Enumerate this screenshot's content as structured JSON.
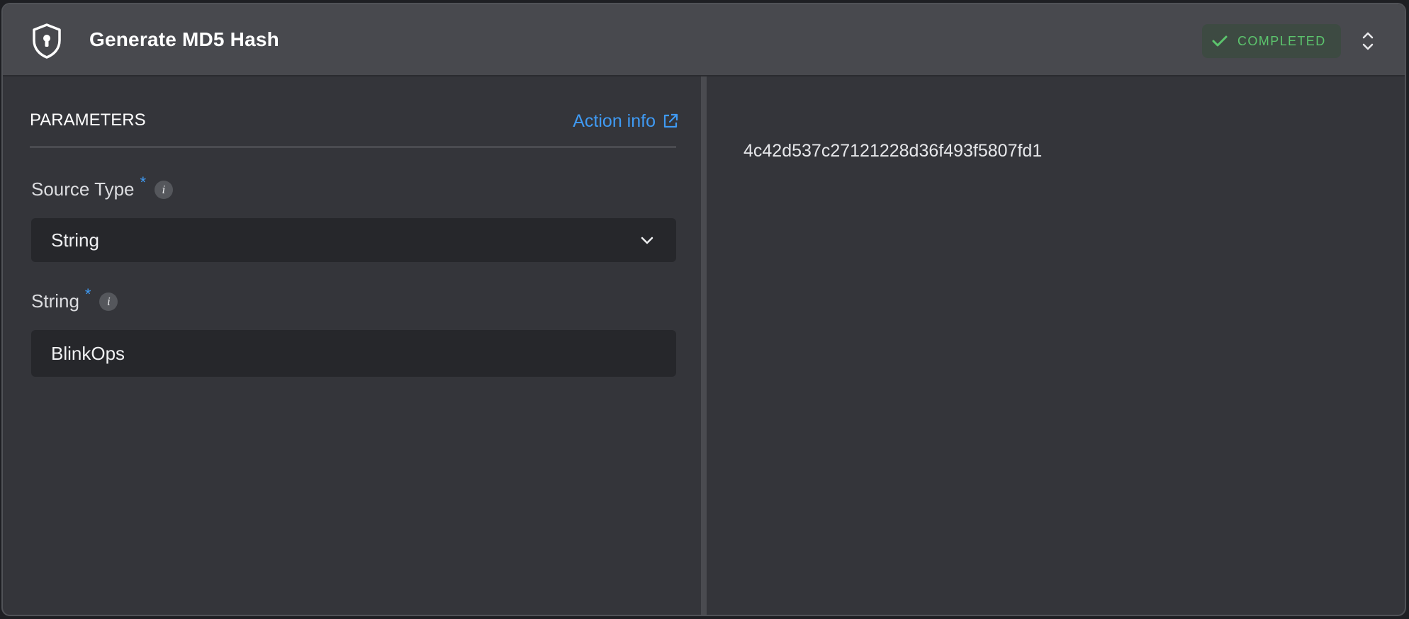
{
  "header": {
    "title": "Generate MD5 Hash",
    "icon": "shield-keyhole-icon",
    "status": {
      "label": "COMPLETED",
      "color": "#5cc46d",
      "icon": "check-icon"
    },
    "expand_icon": "chevron-up-down-icon"
  },
  "parameters": {
    "title": "PARAMETERS",
    "action_info_label": "Action info",
    "action_info_icon": "external-link-icon",
    "fields": [
      {
        "label": "Source Type",
        "required_marker": "*",
        "info_marker": "i",
        "type": "select",
        "value": "String"
      },
      {
        "label": "String",
        "required_marker": "*",
        "info_marker": "i",
        "type": "text",
        "value": "BlinkOps"
      }
    ]
  },
  "output": {
    "value": "4c42d537c27121228d36f493f5807fd1"
  },
  "colors": {
    "accent": "#3f9af3",
    "success": "#5cc46d",
    "panel_bg": "#34353a",
    "header_bg": "#48494e",
    "input_bg": "#26272b"
  }
}
